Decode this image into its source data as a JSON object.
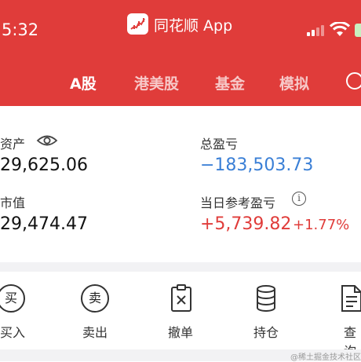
{
  "status_bar": {
    "time": "5:32"
  },
  "app": {
    "title": "同花顺 App"
  },
  "tabs": [
    {
      "label": "A股"
    },
    {
      "label": "港美股"
    },
    {
      "label": "基金"
    },
    {
      "label": "模拟"
    }
  ],
  "assets": {
    "total_assets_label": "资产",
    "total_assets_value": "29,625.06",
    "market_value_label": "市值",
    "market_value_value": "29,474.47",
    "total_pl_label": "总盈亏",
    "total_pl_value": "−183,503.73",
    "today_pl_label": "当日参考盈亏",
    "today_pl_value": "+5,739.82",
    "today_pl_pct": "+1.77%"
  },
  "actions": [
    {
      "label": "买入",
      "glyph": "买",
      "icon": "buy-icon"
    },
    {
      "label": "卖出",
      "glyph": "卖",
      "icon": "sell-icon"
    },
    {
      "label": "撤单",
      "icon": "cancel-order-icon"
    },
    {
      "label": "持仓",
      "icon": "holdings-icon"
    },
    {
      "label": "查询",
      "icon": "query-icon"
    }
  ],
  "watermark": "@稀土掘金技术社区",
  "colors": {
    "brand_red": "#e03c3a",
    "loss_blue": "#3a7fd6",
    "gain_red": "#e03c3a"
  }
}
